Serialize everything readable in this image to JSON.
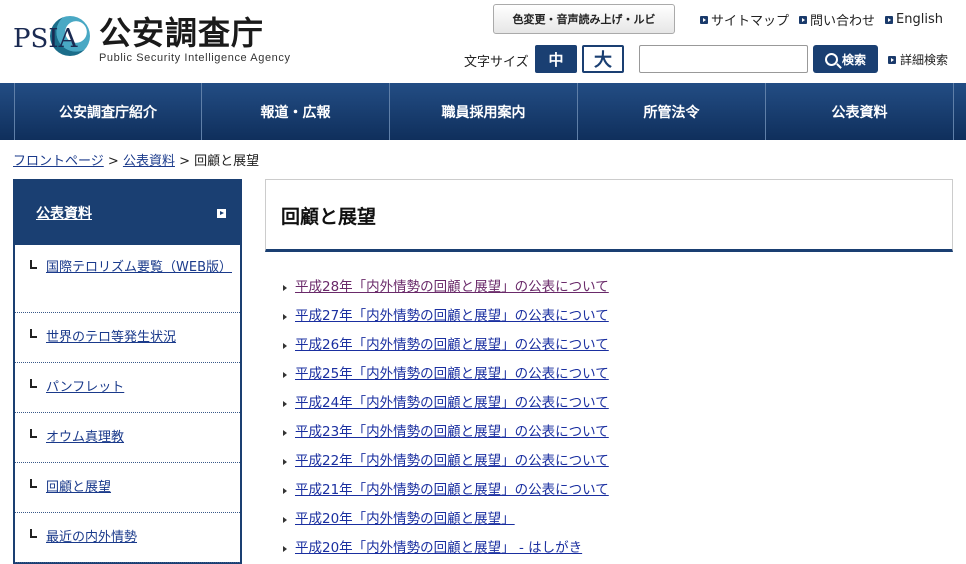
{
  "header": {
    "logo_abbr": "PSIA",
    "logo_name": "公安調査庁",
    "logo_sub": "Public Security Intelligence Agency",
    "accessibility_label": "色変更・音声読み上げ・ルビ",
    "top_links": [
      {
        "label": "サイトマップ",
        "icon": "arrow-square-icon"
      },
      {
        "label": "問い合わせ",
        "icon": "arrow-square-icon"
      },
      {
        "label": "English",
        "icon": "arrow-square-icon"
      }
    ],
    "font_size_label": "文字サイズ",
    "font_size_mid": "中",
    "font_size_large": "大",
    "search_placeholder": "",
    "search_button": "検索",
    "detail_search": "詳細検索"
  },
  "nav": {
    "items": [
      "公安調査庁紹介",
      "報道・広報",
      "職員採用案内",
      "所管法令",
      "公表資料"
    ]
  },
  "breadcrumb": {
    "home": "フロントページ",
    "parent": "公表資料",
    "sep": ">",
    "current": "回顧と展望"
  },
  "sidebar": {
    "heading": "公表資料",
    "items": [
      "国際テロリズム要覧（WEB版）",
      "世界のテロ等発生状況",
      "パンフレット",
      "オウム真理教",
      "回顧と展望",
      "最近の内外情勢"
    ]
  },
  "main": {
    "title": "回顧と展望",
    "links": [
      "平成28年「内外情勢の回顧と展望」の公表について",
      "平成27年「内外情勢の回顧と展望」の公表について",
      "平成26年「内外情勢の回顧と展望」の公表について",
      "平成25年「内外情勢の回顧と展望」の公表について",
      "平成24年「内外情勢の回顧と展望」の公表について",
      "平成23年「内外情勢の回顧と展望」の公表について",
      "平成22年「内外情勢の回顧と展望」の公表について",
      "平成21年「内外情勢の回顧と展望」の公表について",
      "平成20年「内外情勢の回顧と展望」",
      "平成20年「内外情勢の回顧と展望」 - はしがき"
    ]
  },
  "colors": {
    "brand_navy": "#1a3f72",
    "link": "#1a2fa0",
    "visited_link": "#6a2a6a"
  }
}
